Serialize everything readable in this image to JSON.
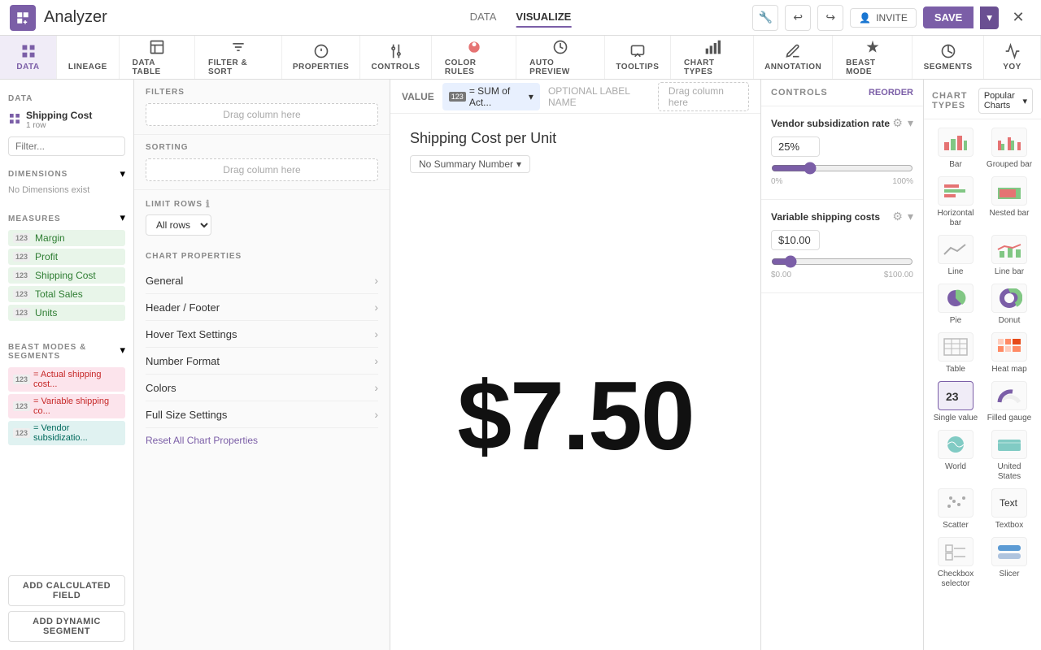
{
  "app": {
    "title": "Analyzer",
    "icon": "A"
  },
  "top_nav": {
    "items": [
      {
        "id": "data",
        "label": "DATA",
        "active": false
      },
      {
        "id": "visualize",
        "label": "VISUALIZE",
        "active": true
      }
    ]
  },
  "top_actions": {
    "invite_label": "INVITE",
    "save_label": "SAVE"
  },
  "toolbar": {
    "items": [
      {
        "id": "data",
        "label": "DATA",
        "active": true,
        "icon": "data"
      },
      {
        "id": "lineage",
        "label": "LINEAGE",
        "active": false,
        "icon": "lineage"
      },
      {
        "id": "data-table",
        "label": "DATA TABLE",
        "active": false,
        "icon": "table"
      },
      {
        "id": "filter-sort",
        "label": "FILTER & SORT",
        "active": false,
        "icon": "filter"
      },
      {
        "id": "properties",
        "label": "PROPERTIES",
        "active": false,
        "icon": "properties"
      },
      {
        "id": "controls",
        "label": "CONTROLS",
        "active": false,
        "icon": "controls"
      },
      {
        "id": "color-rules",
        "label": "COLOR RULES",
        "active": false,
        "icon": "color"
      },
      {
        "id": "auto-preview",
        "label": "AUTO PREVIEW",
        "active": false,
        "icon": "preview"
      },
      {
        "id": "tooltips",
        "label": "TOOLTIPS",
        "active": false,
        "icon": "tooltip"
      },
      {
        "id": "chart-types",
        "label": "CHART TYPES",
        "active": false,
        "icon": "chart"
      },
      {
        "id": "annotation",
        "label": "ANNOTATION",
        "active": false,
        "icon": "annotation"
      },
      {
        "id": "beast-mode",
        "label": "BEAST MODE",
        "active": false,
        "icon": "beast"
      },
      {
        "id": "segments",
        "label": "SEGMENTS",
        "active": false,
        "icon": "segments"
      },
      {
        "id": "yoy",
        "label": "YOY",
        "active": false,
        "icon": "yoy"
      }
    ]
  },
  "sidebar": {
    "data_section": "DATA",
    "data_item": {
      "label": "Shipping Cost",
      "sub": "1 row"
    },
    "filter_placeholder": "Filter...",
    "dimensions_label": "DIMENSIONS",
    "no_dimensions": "No Dimensions exist",
    "measures_label": "MEASURES",
    "measures": [
      {
        "label": "Margin",
        "badge": "123"
      },
      {
        "label": "Profit",
        "badge": "123"
      },
      {
        "label": "Shipping Cost",
        "badge": "123"
      },
      {
        "label": "Total Sales",
        "badge": "123"
      },
      {
        "label": "Units",
        "badge": "123"
      }
    ],
    "beast_label": "BEAST MODES & SEGMENTS",
    "beast_items": [
      {
        "label": "= Actual shipping cost...",
        "badge": "123",
        "color": "pink"
      },
      {
        "label": "= Variable shipping co...",
        "badge": "123",
        "color": "pink"
      },
      {
        "label": "= Vendor subsidizatio...",
        "badge": "123",
        "color": "teal"
      }
    ],
    "add_calculated": "ADD CALCULATED FIELD",
    "add_dynamic": "ADD DYNAMIC SEGMENT"
  },
  "filters": {
    "title": "FILTERS",
    "drop_placeholder": "Drag column here",
    "sorting_title": "SORTING",
    "sorting_placeholder": "Drag column here",
    "limit_title": "LIMIT ROWS",
    "limit_value": "All rows"
  },
  "chart_properties": {
    "title": "CHART PROPERTIES",
    "items": [
      "General",
      "Header / Footer",
      "Hover Text Settings",
      "Number Format",
      "Colors",
      "Full Size Settings"
    ],
    "reset_label": "Reset All Chart Properties"
  },
  "value_bar": {
    "value_label": "VALUE",
    "chip_badge": "123",
    "chip_text": "= SUM of Act...",
    "optional_label": "OPTIONAL LABEL NAME",
    "drag_label": "Drag column here"
  },
  "chart": {
    "title": "Shipping Cost per Unit",
    "summary_label": "No Summary Number",
    "main_value": "$7.50"
  },
  "controls": {
    "title": "CONTROLS",
    "reorder": "REORDER",
    "blocks": [
      {
        "id": "vendor",
        "title": "Vendor subsidization rate",
        "input_value": "25%",
        "slider_min": "0%",
        "slider_max": "100%",
        "slider_val": 25
      },
      {
        "id": "variable",
        "title": "Variable shipping costs",
        "input_value": "$10.00",
        "slider_min": "$0.00",
        "slider_max": "$100.00",
        "slider_val": 10
      }
    ]
  },
  "chart_types": {
    "title": "CHART TYPES",
    "dropdown_label": "Popular Charts",
    "types": [
      {
        "id": "bar",
        "label": "Bar",
        "active": false,
        "color": "#e57373"
      },
      {
        "id": "grouped-bar",
        "label": "Grouped bar",
        "active": false,
        "color": "#81c784"
      },
      {
        "id": "horizontal-bar",
        "label": "Horizontal bar",
        "active": false,
        "color": "#e57373"
      },
      {
        "id": "nested-bar",
        "label": "Nested bar",
        "active": false,
        "color": "#81c784"
      },
      {
        "id": "line",
        "label": "Line",
        "active": false,
        "color": "#aaa"
      },
      {
        "id": "line-bar",
        "label": "Line bar",
        "active": false,
        "color": "#81c784"
      },
      {
        "id": "pie",
        "label": "Pie",
        "active": false,
        "color": "#7b5ea7"
      },
      {
        "id": "donut",
        "label": "Donut",
        "active": false,
        "color": "#7b5ea7"
      },
      {
        "id": "table",
        "label": "Table",
        "active": false,
        "color": "#eee"
      },
      {
        "id": "heat-map",
        "label": "Heat map",
        "active": false,
        "color": "#ff8a65"
      },
      {
        "id": "single-value",
        "label": "Single value",
        "active": true,
        "color": "#333"
      },
      {
        "id": "filled-gauge",
        "label": "Filled gauge",
        "active": false,
        "color": "#7b5ea7"
      },
      {
        "id": "world",
        "label": "World",
        "active": false,
        "color": "#4db6ac"
      },
      {
        "id": "united-states",
        "label": "United States",
        "active": false,
        "color": "#4db6ac"
      },
      {
        "id": "scatter",
        "label": "Scatter",
        "active": false,
        "color": "#aaa"
      },
      {
        "id": "textbox",
        "label": "Textbox",
        "active": false,
        "color": "#333"
      },
      {
        "id": "checkbox-selector",
        "label": "Checkbox selector",
        "active": false,
        "color": "#eee"
      },
      {
        "id": "slicer",
        "label": "Slicer",
        "active": false,
        "color": "#5c9bd4"
      }
    ]
  }
}
